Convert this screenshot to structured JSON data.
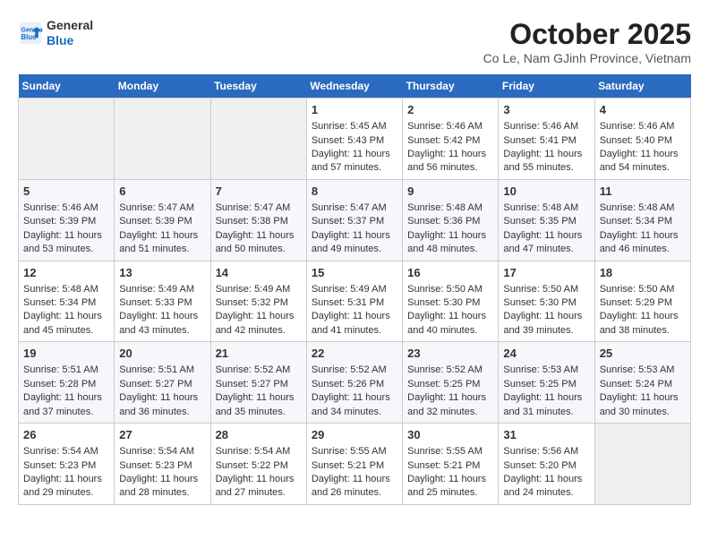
{
  "header": {
    "logo_general": "General",
    "logo_blue": "Blue",
    "title": "October 2025",
    "subtitle": "Co Le, Nam GJinh Province, Vietnam"
  },
  "weekdays": [
    "Sunday",
    "Monday",
    "Tuesday",
    "Wednesday",
    "Thursday",
    "Friday",
    "Saturday"
  ],
  "weeks": [
    [
      {
        "day": "",
        "info": ""
      },
      {
        "day": "",
        "info": ""
      },
      {
        "day": "",
        "info": ""
      },
      {
        "day": "1",
        "info": "Sunrise: 5:45 AM\nSunset: 5:43 PM\nDaylight: 11 hours and 57 minutes."
      },
      {
        "day": "2",
        "info": "Sunrise: 5:46 AM\nSunset: 5:42 PM\nDaylight: 11 hours and 56 minutes."
      },
      {
        "day": "3",
        "info": "Sunrise: 5:46 AM\nSunset: 5:41 PM\nDaylight: 11 hours and 55 minutes."
      },
      {
        "day": "4",
        "info": "Sunrise: 5:46 AM\nSunset: 5:40 PM\nDaylight: 11 hours and 54 minutes."
      }
    ],
    [
      {
        "day": "5",
        "info": "Sunrise: 5:46 AM\nSunset: 5:39 PM\nDaylight: 11 hours and 53 minutes."
      },
      {
        "day": "6",
        "info": "Sunrise: 5:47 AM\nSunset: 5:39 PM\nDaylight: 11 hours and 51 minutes."
      },
      {
        "day": "7",
        "info": "Sunrise: 5:47 AM\nSunset: 5:38 PM\nDaylight: 11 hours and 50 minutes."
      },
      {
        "day": "8",
        "info": "Sunrise: 5:47 AM\nSunset: 5:37 PM\nDaylight: 11 hours and 49 minutes."
      },
      {
        "day": "9",
        "info": "Sunrise: 5:48 AM\nSunset: 5:36 PM\nDaylight: 11 hours and 48 minutes."
      },
      {
        "day": "10",
        "info": "Sunrise: 5:48 AM\nSunset: 5:35 PM\nDaylight: 11 hours and 47 minutes."
      },
      {
        "day": "11",
        "info": "Sunrise: 5:48 AM\nSunset: 5:34 PM\nDaylight: 11 hours and 46 minutes."
      }
    ],
    [
      {
        "day": "12",
        "info": "Sunrise: 5:48 AM\nSunset: 5:34 PM\nDaylight: 11 hours and 45 minutes."
      },
      {
        "day": "13",
        "info": "Sunrise: 5:49 AM\nSunset: 5:33 PM\nDaylight: 11 hours and 43 minutes."
      },
      {
        "day": "14",
        "info": "Sunrise: 5:49 AM\nSunset: 5:32 PM\nDaylight: 11 hours and 42 minutes."
      },
      {
        "day": "15",
        "info": "Sunrise: 5:49 AM\nSunset: 5:31 PM\nDaylight: 11 hours and 41 minutes."
      },
      {
        "day": "16",
        "info": "Sunrise: 5:50 AM\nSunset: 5:30 PM\nDaylight: 11 hours and 40 minutes."
      },
      {
        "day": "17",
        "info": "Sunrise: 5:50 AM\nSunset: 5:30 PM\nDaylight: 11 hours and 39 minutes."
      },
      {
        "day": "18",
        "info": "Sunrise: 5:50 AM\nSunset: 5:29 PM\nDaylight: 11 hours and 38 minutes."
      }
    ],
    [
      {
        "day": "19",
        "info": "Sunrise: 5:51 AM\nSunset: 5:28 PM\nDaylight: 11 hours and 37 minutes."
      },
      {
        "day": "20",
        "info": "Sunrise: 5:51 AM\nSunset: 5:27 PM\nDaylight: 11 hours and 36 minutes."
      },
      {
        "day": "21",
        "info": "Sunrise: 5:52 AM\nSunset: 5:27 PM\nDaylight: 11 hours and 35 minutes."
      },
      {
        "day": "22",
        "info": "Sunrise: 5:52 AM\nSunset: 5:26 PM\nDaylight: 11 hours and 34 minutes."
      },
      {
        "day": "23",
        "info": "Sunrise: 5:52 AM\nSunset: 5:25 PM\nDaylight: 11 hours and 32 minutes."
      },
      {
        "day": "24",
        "info": "Sunrise: 5:53 AM\nSunset: 5:25 PM\nDaylight: 11 hours and 31 minutes."
      },
      {
        "day": "25",
        "info": "Sunrise: 5:53 AM\nSunset: 5:24 PM\nDaylight: 11 hours and 30 minutes."
      }
    ],
    [
      {
        "day": "26",
        "info": "Sunrise: 5:54 AM\nSunset: 5:23 PM\nDaylight: 11 hours and 29 minutes."
      },
      {
        "day": "27",
        "info": "Sunrise: 5:54 AM\nSunset: 5:23 PM\nDaylight: 11 hours and 28 minutes."
      },
      {
        "day": "28",
        "info": "Sunrise: 5:54 AM\nSunset: 5:22 PM\nDaylight: 11 hours and 27 minutes."
      },
      {
        "day": "29",
        "info": "Sunrise: 5:55 AM\nSunset: 5:21 PM\nDaylight: 11 hours and 26 minutes."
      },
      {
        "day": "30",
        "info": "Sunrise: 5:55 AM\nSunset: 5:21 PM\nDaylight: 11 hours and 25 minutes."
      },
      {
        "day": "31",
        "info": "Sunrise: 5:56 AM\nSunset: 5:20 PM\nDaylight: 11 hours and 24 minutes."
      },
      {
        "day": "",
        "info": ""
      }
    ]
  ]
}
